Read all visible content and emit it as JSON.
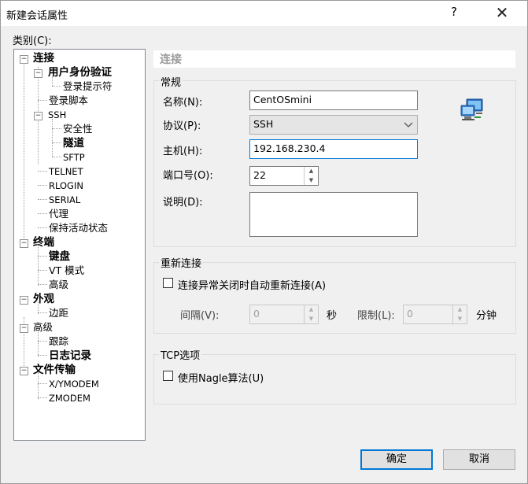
{
  "window": {
    "title": "新建会话属性",
    "help": "?",
    "close": "✕"
  },
  "category_label": "类别(C):",
  "tree": {
    "connection": "连接",
    "auth": "用户身份验证",
    "login_prompt": "登录提示符",
    "login_script": "登录脚本",
    "ssh": "SSH",
    "security": "安全性",
    "tunnel": "隧道",
    "sftp": "SFTP",
    "telnet": "TELNET",
    "rlogin": "RLOGIN",
    "serial": "SERIAL",
    "proxy": "代理",
    "keepalive": "保持活动状态",
    "terminal": "终端",
    "keyboard": "键盘",
    "vt_mode": "VT 模式",
    "advanced": "高级",
    "appearance": "外观",
    "margin": "边距",
    "advanced2": "高级",
    "trace": "跟踪",
    "logging": "日志记录",
    "file_transfer": "文件传输",
    "xymodem": "X/YMODEM",
    "zmodem": "ZMODEM"
  },
  "panel": {
    "header": "连接",
    "general": {
      "legend": "常规",
      "name_label": "名称(N):",
      "name_value": "CentOSmini",
      "protocol_label": "协议(P):",
      "protocol_value": "SSH",
      "host_label": "主机(H):",
      "host_value": "192.168.230.4",
      "port_label": "端口号(O):",
      "port_value": "22",
      "desc_label": "说明(D):",
      "desc_value": ""
    },
    "reconnect": {
      "legend": "重新连接",
      "auto_reconnect_label": "连接异常关闭时自动重新连接(A)",
      "auto_reconnect_checked": false,
      "interval_label": "间隔(V):",
      "interval_value": "0",
      "interval_unit": "秒",
      "limit_label": "限制(L):",
      "limit_value": "0",
      "limit_unit": "分钟"
    },
    "tcp": {
      "legend": "TCP选项",
      "nagle_label": "使用Nagle算法(U)",
      "nagle_checked": false
    }
  },
  "buttons": {
    "ok": "确定",
    "cancel": "取消"
  },
  "colors": {
    "accent": "#0078d7",
    "header_text": "#9b9b9b"
  }
}
